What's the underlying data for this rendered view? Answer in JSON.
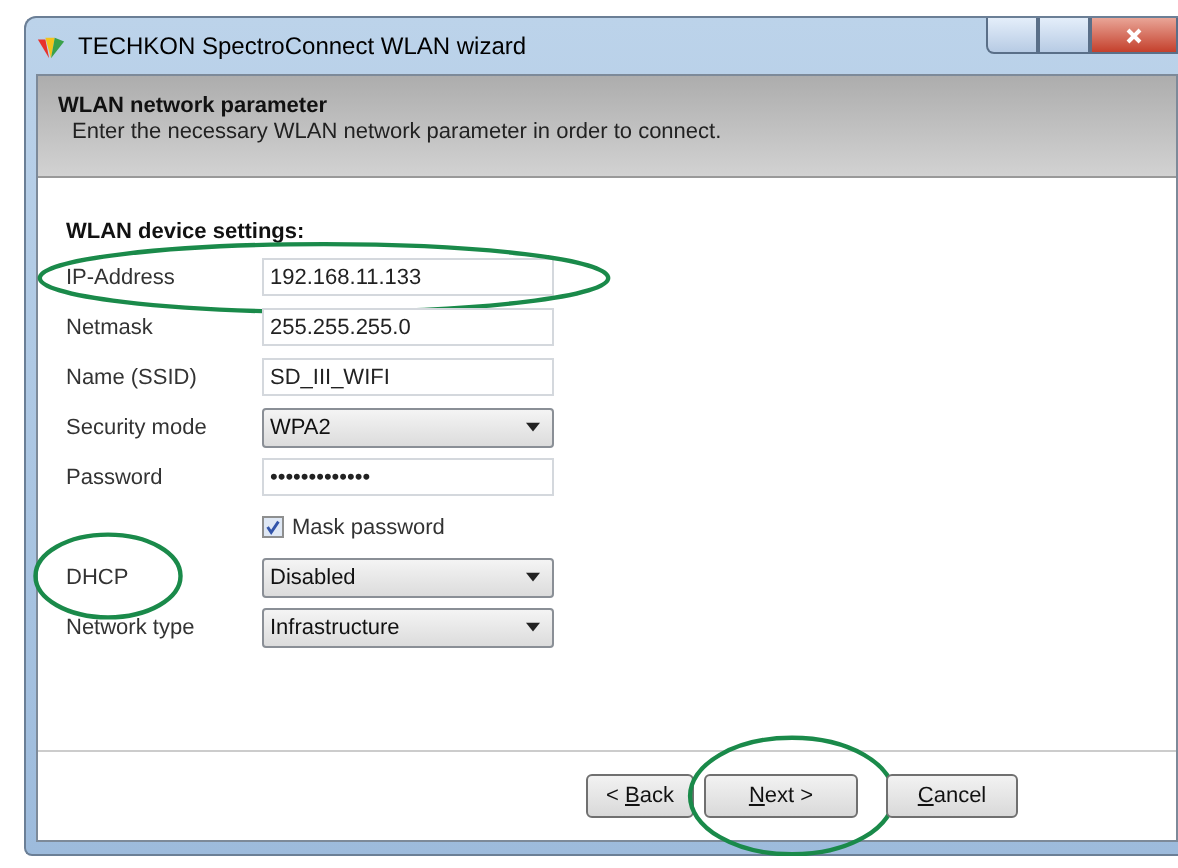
{
  "window": {
    "title": "TECHKON SpectroConnect WLAN wizard"
  },
  "header": {
    "title": "WLAN network parameter",
    "subtitle": "Enter the necessary WLAN network parameter in order to connect."
  },
  "section": {
    "title": "WLAN device settings:"
  },
  "fields": [
    {
      "kind": "text",
      "label": "IP-Address",
      "value": "192.168.11.133",
      "circled": true
    },
    {
      "kind": "text",
      "label": "Netmask",
      "value": "255.255.255.0"
    },
    {
      "kind": "text",
      "label": "Name (SSID)",
      "value": "SD_III_WIFI"
    },
    {
      "kind": "select",
      "label": "Security mode",
      "value": "WPA2"
    },
    {
      "kind": "password",
      "label": "Password",
      "value": "•••••••••••••"
    },
    {
      "kind": "checkbox",
      "label": "Mask password",
      "checked": true
    },
    {
      "kind": "select",
      "label": "DHCP",
      "value": "Disabled",
      "label_circled": true
    },
    {
      "kind": "select",
      "label": "Network type",
      "value": "Infrastructure"
    }
  ],
  "buttons": [
    {
      "prefix": "< ",
      "mnemonic": "B",
      "suffix": "ack"
    },
    {
      "mnemonic": "N",
      "suffix": "ext >",
      "circled": true
    },
    {
      "mnemonic": "C",
      "suffix": "ancel"
    }
  ]
}
